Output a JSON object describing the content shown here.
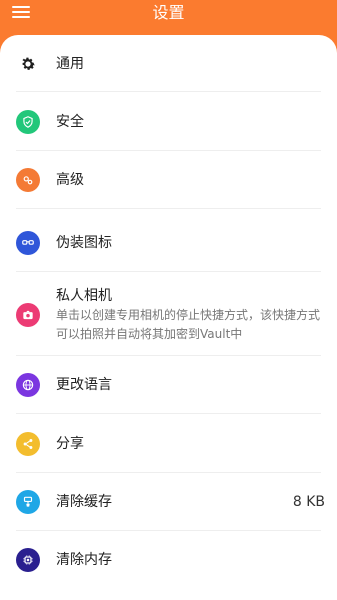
{
  "header": {
    "title": "设置"
  },
  "menu": {
    "icon": "menu-icon"
  },
  "items": [
    {
      "label": "通用",
      "icon": "gear-icon",
      "color": "#1f1f1f"
    },
    {
      "label": "安全",
      "icon": "shield-check-icon",
      "color": "#22c77a"
    },
    {
      "label": "高级",
      "icon": "advanced-icon",
      "color": "#f47a35"
    },
    {
      "label": "伪装图标",
      "icon": "disguise-icon",
      "color": "#2f56d9"
    },
    {
      "label": "私人相机",
      "description": "单击以创建专用相机的停止快捷方式，该快捷方式可以拍照并自动将其加密到Vault中",
      "icon": "camera-icon",
      "color": "#ec3b74"
    },
    {
      "label": "更改语言",
      "icon": "globe-icon",
      "color": "#7b36e0"
    },
    {
      "label": "分享",
      "icon": "share-icon",
      "color": "#f3bd2e"
    },
    {
      "label": "清除缓存",
      "value": "8 KB",
      "icon": "brush-icon",
      "color": "#1fa7e6"
    },
    {
      "label": "清除内存",
      "icon": "chip-icon",
      "color": "#2a1f8f"
    }
  ]
}
